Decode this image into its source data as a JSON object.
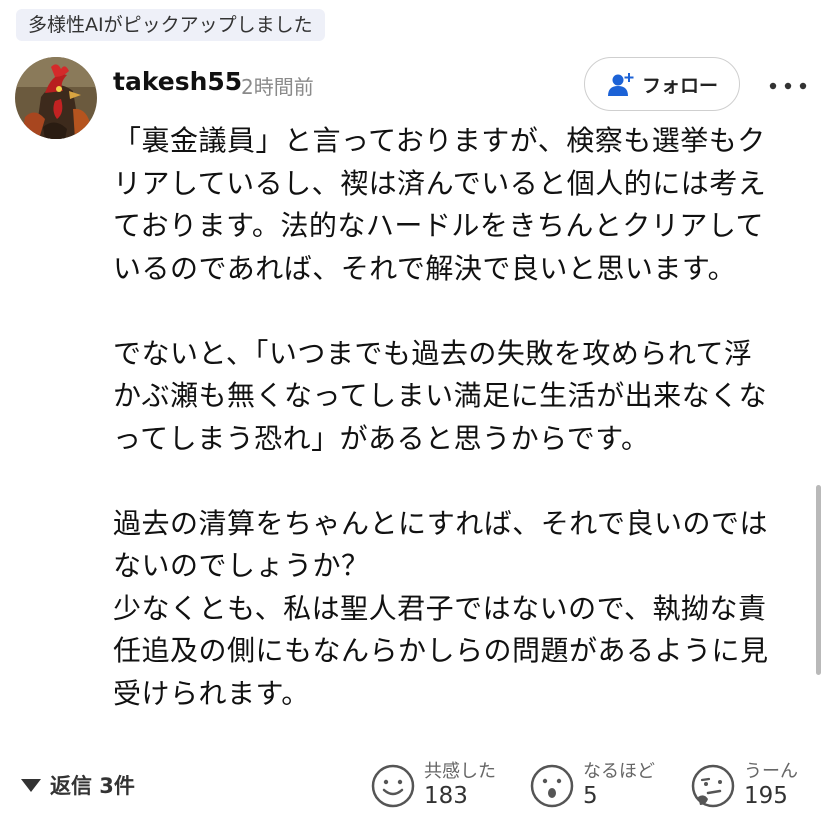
{
  "badge": {
    "text": "多様性AIがピックアップしました"
  },
  "comment": {
    "username": "takesh55",
    "timestamp": "2時間前",
    "follow_label": "フォロー",
    "lines": [
      "「裏金議員」と言っておりますが、検察も選挙もク",
      "リアしているし、禊は済んでいると個人的には考え",
      "ております。法的なハードルをきちんとクリアして",
      "いるのであれば、それで解決で良いと思います。",
      "",
      "でないと、「いつまでも過去の失敗を攻められて浮",
      "かぶ瀬も無くなってしまい満足に生活が出来なくな",
      "ってしまう恐れ」があると思うからです。",
      "",
      "過去の清算をちゃんとにすれば、それで良いのでは",
      "ないのでしょうか？",
      "少なくとも、私は聖人君子ではないので、執拗な責",
      "任追及の側にもなんらかしらの問題があるように見",
      "受けられます。"
    ]
  },
  "footer": {
    "replies_label": "返信 3件",
    "reactions": [
      {
        "label": "共感した",
        "count": "183",
        "icon": "smile-face-icon"
      },
      {
        "label": "なるほど",
        "count": "5",
        "icon": "surprised-face-icon"
      },
      {
        "label": "うーん",
        "count": "195",
        "icon": "thinking-face-icon"
      }
    ]
  },
  "colors": {
    "badge_bg": "#eef0f8",
    "follow_icon": "#1c62d6",
    "muted_text": "#8a8a8a",
    "icon_gray": "#555555"
  }
}
